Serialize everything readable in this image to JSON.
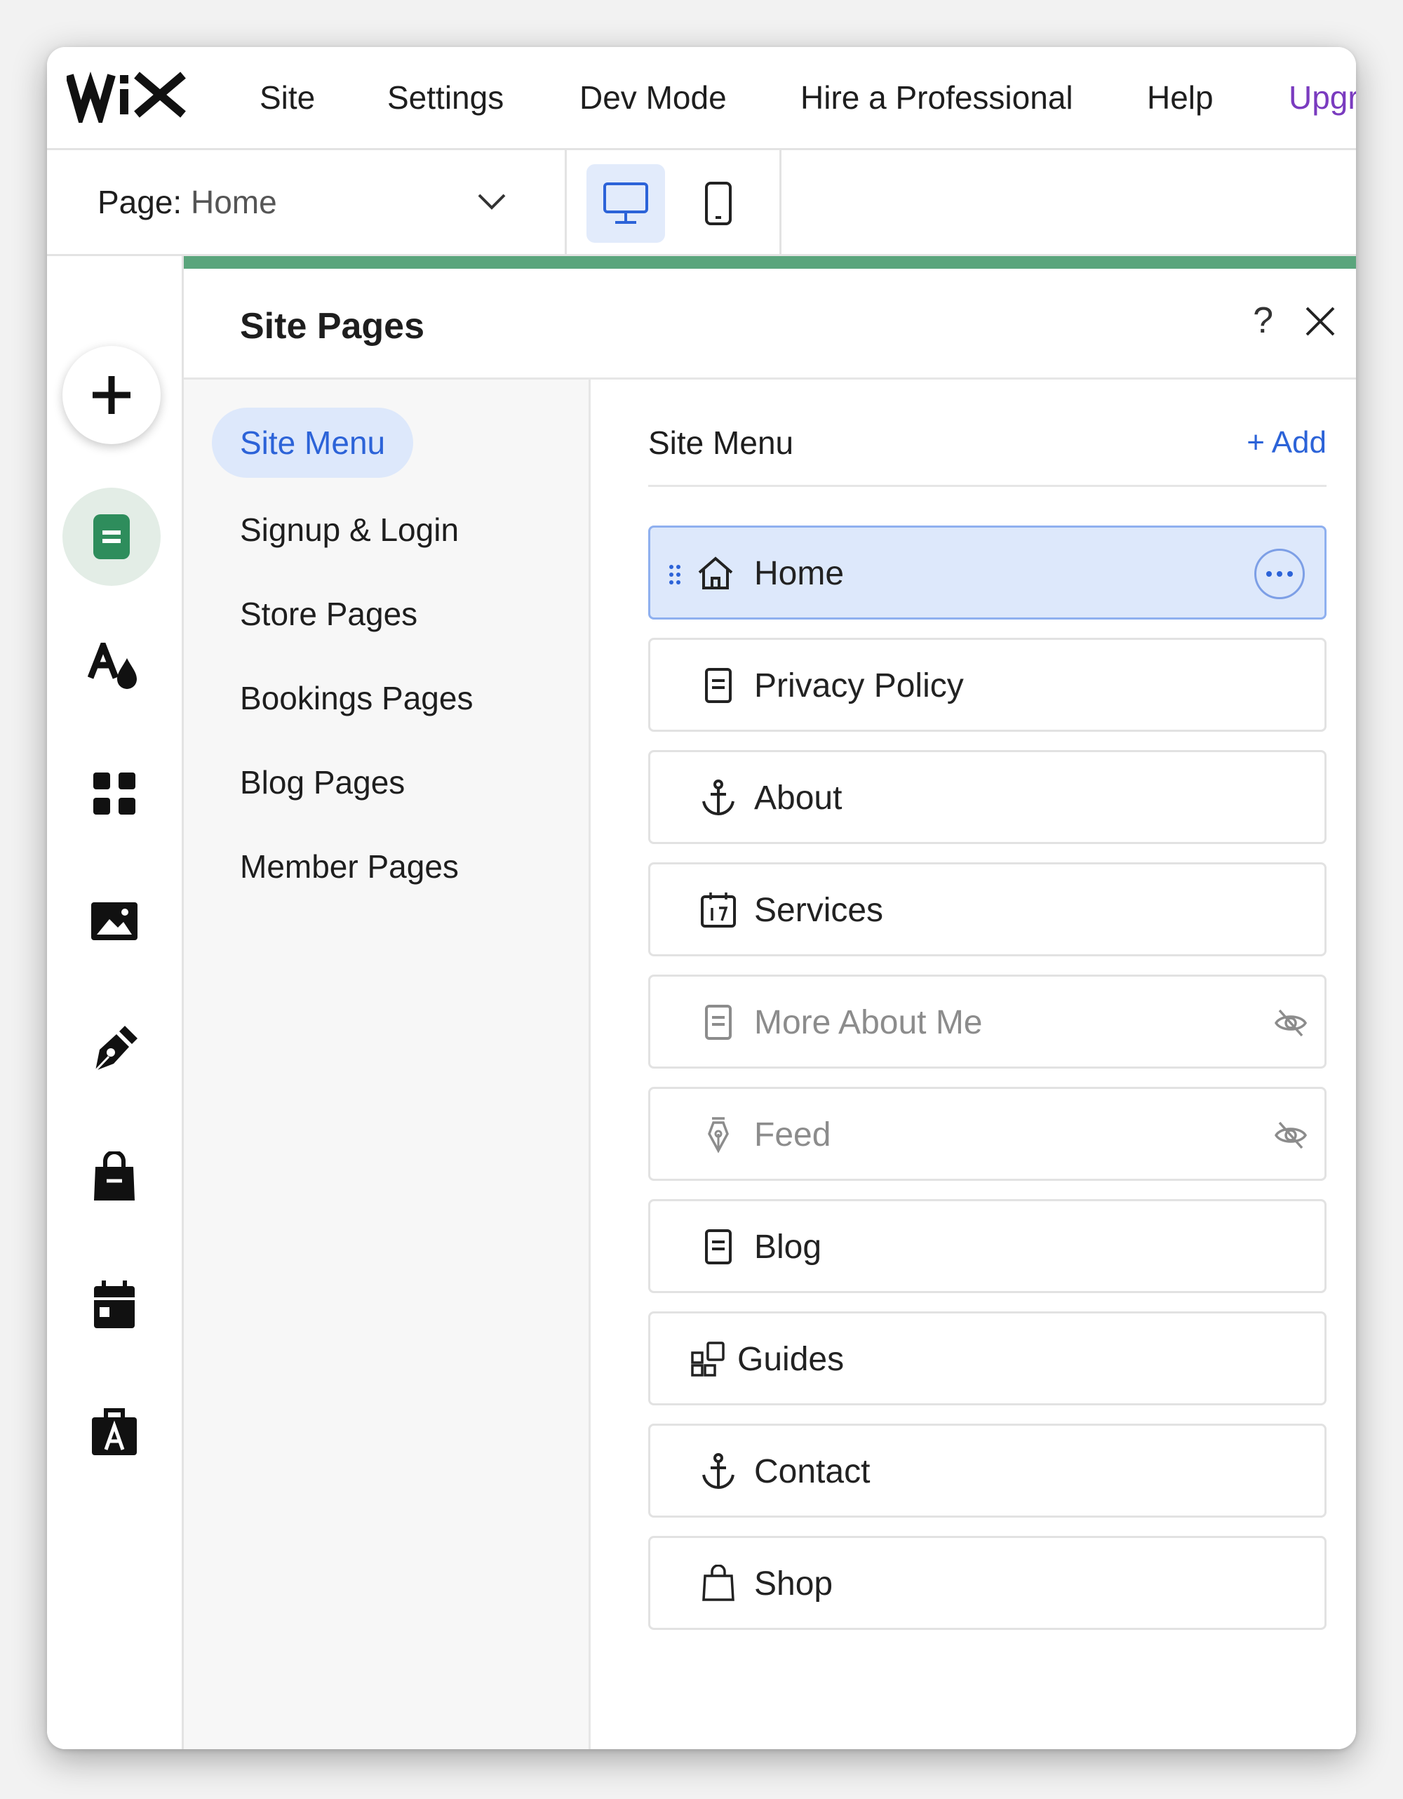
{
  "topbar": {
    "logo_text": "WiX",
    "nav": {
      "site": "Site",
      "settings": "Settings",
      "dev_mode": "Dev Mode",
      "hire": "Hire a Professional",
      "help": "Help",
      "upgrade": "Upgr"
    }
  },
  "pagebar": {
    "page_label": "Page:",
    "page_value": "Home",
    "devices": [
      "desktop-icon",
      "mobile-icon"
    ],
    "active_device": "desktop"
  },
  "rail": {
    "icons": [
      "plus-icon",
      "pages-icon",
      "design-icon",
      "apps-icon",
      "media-icon",
      "blog-pen-icon",
      "store-bag-icon",
      "calendar-icon",
      "portfolio-icon"
    ]
  },
  "panel": {
    "title": "Site Pages",
    "help": "?",
    "categories": [
      "Site Menu",
      "Signup & Login",
      "Store Pages",
      "Bookings Pages",
      "Blog Pages",
      "Member Pages"
    ],
    "list_title": "Site Menu",
    "add_label": "+ Add",
    "pages": [
      {
        "label": "Home",
        "icon": "home-icon",
        "hidden": false,
        "selected": true
      },
      {
        "label": "Privacy Policy",
        "icon": "page-icon",
        "hidden": false
      },
      {
        "label": "About",
        "icon": "anchor-icon",
        "hidden": false
      },
      {
        "label": "Services",
        "icon": "calendar-icon",
        "hidden": false
      },
      {
        "label": "More About Me",
        "icon": "page-icon",
        "hidden": true
      },
      {
        "label": "Feed",
        "icon": "pen-icon",
        "hidden": true
      },
      {
        "label": "Blog",
        "icon": "page-icon",
        "hidden": false
      },
      {
        "label": "Guides",
        "icon": "dynamic-page-icon",
        "hidden": false
      },
      {
        "label": "Contact",
        "icon": "anchor-icon",
        "hidden": false
      },
      {
        "label": "Shop",
        "icon": "bag-icon",
        "hidden": false
      }
    ]
  },
  "colors": {
    "accent_blue": "#2c63d8",
    "selected_row": "#dde8fb",
    "green_strip": "#5aa57c",
    "upgrade_purple": "#7a3bbf"
  }
}
